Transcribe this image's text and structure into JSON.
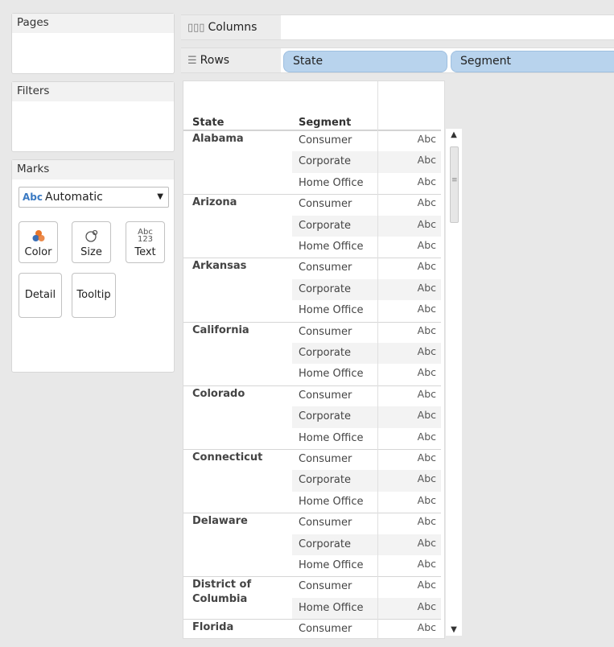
{
  "cards": {
    "pages": "Pages",
    "filters": "Filters",
    "marks": "Marks"
  },
  "marks": {
    "type_icon": "Abc",
    "type": "Automatic",
    "buttons": {
      "color": "Color",
      "size": "Size",
      "text": "Text",
      "text_icon_top": "Abc",
      "text_icon_bottom": "123",
      "detail": "Detail",
      "tooltip": "Tooltip"
    }
  },
  "shelves": {
    "columns": "Columns",
    "rows": "Rows",
    "row_pills": [
      "State",
      "Segment"
    ]
  },
  "table": {
    "headers": {
      "state": "State",
      "segment": "Segment"
    },
    "rows": [
      {
        "state": "Alabama",
        "segment": "Consumer",
        "mark": "Abc"
      },
      {
        "state": "",
        "segment": "Corporate",
        "mark": "Abc"
      },
      {
        "state": "",
        "segment": "Home Office",
        "mark": "Abc"
      },
      {
        "state": "Arizona",
        "segment": "Consumer",
        "mark": "Abc"
      },
      {
        "state": "",
        "segment": "Corporate",
        "mark": "Abc"
      },
      {
        "state": "",
        "segment": "Home Office",
        "mark": "Abc"
      },
      {
        "state": "Arkansas",
        "segment": "Consumer",
        "mark": "Abc"
      },
      {
        "state": "",
        "segment": "Corporate",
        "mark": "Abc"
      },
      {
        "state": "",
        "segment": "Home Office",
        "mark": "Abc"
      },
      {
        "state": "California",
        "segment": "Consumer",
        "mark": "Abc"
      },
      {
        "state": "",
        "segment": "Corporate",
        "mark": "Abc"
      },
      {
        "state": "",
        "segment": "Home Office",
        "mark": "Abc"
      },
      {
        "state": "Colorado",
        "segment": "Consumer",
        "mark": "Abc"
      },
      {
        "state": "",
        "segment": "Corporate",
        "mark": "Abc"
      },
      {
        "state": "",
        "segment": "Home Office",
        "mark": "Abc"
      },
      {
        "state": "Connecticut",
        "segment": "Consumer",
        "mark": "Abc"
      },
      {
        "state": "",
        "segment": "Corporate",
        "mark": "Abc"
      },
      {
        "state": "",
        "segment": "Home Office",
        "mark": "Abc"
      },
      {
        "state": "Delaware",
        "segment": "Consumer",
        "mark": "Abc"
      },
      {
        "state": "",
        "segment": "Corporate",
        "mark": "Abc"
      },
      {
        "state": "",
        "segment": "Home Office",
        "mark": "Abc"
      },
      {
        "state": "District of Columbia",
        "segment": "Consumer",
        "mark": "Abc"
      },
      {
        "state": "",
        "segment": "Home Office",
        "mark": "Abc"
      },
      {
        "state": "Florida",
        "segment": "Consumer",
        "mark": "Abc"
      }
    ]
  },
  "colors": {
    "pill": "#b8d3ed",
    "accent_abc": "#3a7ac3"
  }
}
